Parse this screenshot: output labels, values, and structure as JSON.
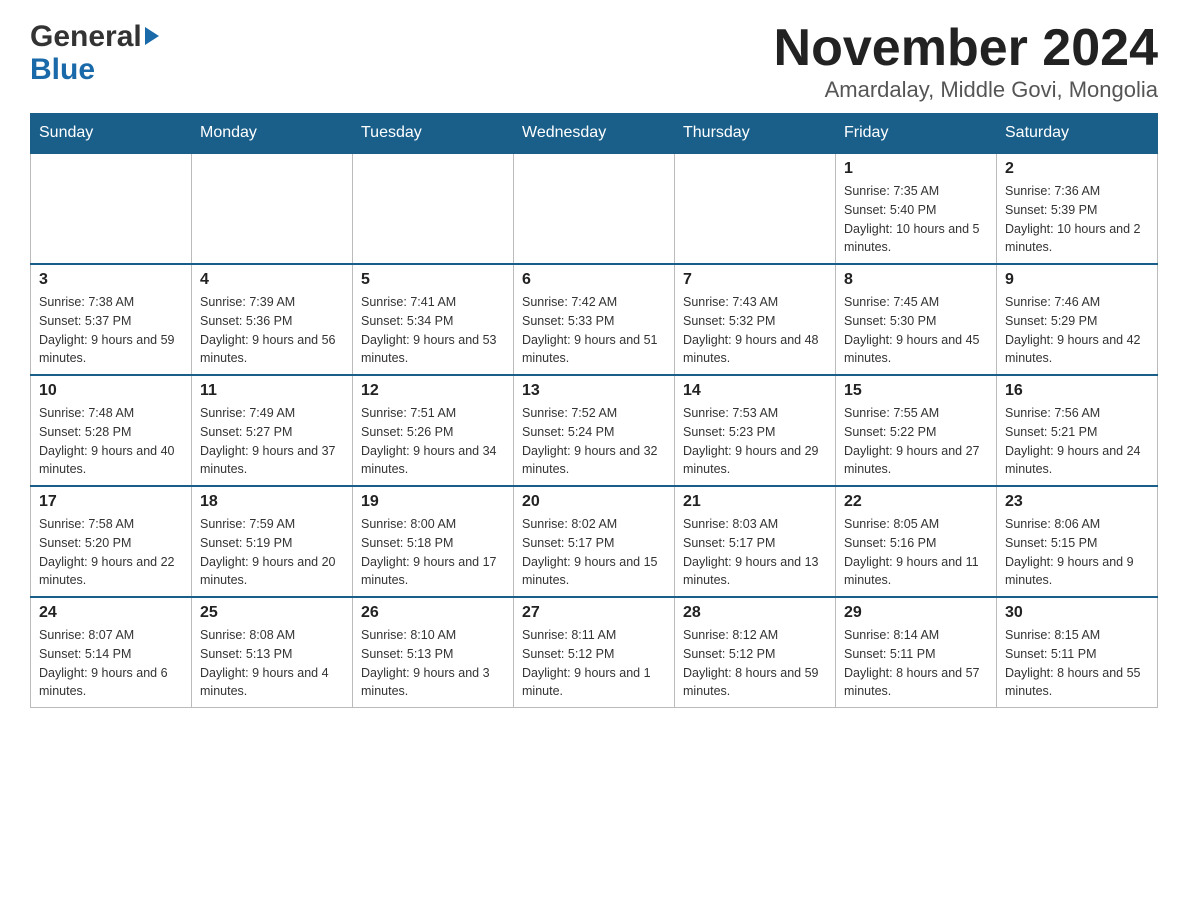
{
  "header": {
    "logo_line1": "General",
    "logo_line2": "Blue",
    "month_title": "November 2024",
    "location": "Amardalay, Middle Govi, Mongolia"
  },
  "days_of_week": [
    "Sunday",
    "Monday",
    "Tuesday",
    "Wednesday",
    "Thursday",
    "Friday",
    "Saturday"
  ],
  "weeks": [
    [
      {
        "day": "",
        "info": ""
      },
      {
        "day": "",
        "info": ""
      },
      {
        "day": "",
        "info": ""
      },
      {
        "day": "",
        "info": ""
      },
      {
        "day": "",
        "info": ""
      },
      {
        "day": "1",
        "info": "Sunrise: 7:35 AM\nSunset: 5:40 PM\nDaylight: 10 hours and 5 minutes."
      },
      {
        "day": "2",
        "info": "Sunrise: 7:36 AM\nSunset: 5:39 PM\nDaylight: 10 hours and 2 minutes."
      }
    ],
    [
      {
        "day": "3",
        "info": "Sunrise: 7:38 AM\nSunset: 5:37 PM\nDaylight: 9 hours and 59 minutes."
      },
      {
        "day": "4",
        "info": "Sunrise: 7:39 AM\nSunset: 5:36 PM\nDaylight: 9 hours and 56 minutes."
      },
      {
        "day": "5",
        "info": "Sunrise: 7:41 AM\nSunset: 5:34 PM\nDaylight: 9 hours and 53 minutes."
      },
      {
        "day": "6",
        "info": "Sunrise: 7:42 AM\nSunset: 5:33 PM\nDaylight: 9 hours and 51 minutes."
      },
      {
        "day": "7",
        "info": "Sunrise: 7:43 AM\nSunset: 5:32 PM\nDaylight: 9 hours and 48 minutes."
      },
      {
        "day": "8",
        "info": "Sunrise: 7:45 AM\nSunset: 5:30 PM\nDaylight: 9 hours and 45 minutes."
      },
      {
        "day": "9",
        "info": "Sunrise: 7:46 AM\nSunset: 5:29 PM\nDaylight: 9 hours and 42 minutes."
      }
    ],
    [
      {
        "day": "10",
        "info": "Sunrise: 7:48 AM\nSunset: 5:28 PM\nDaylight: 9 hours and 40 minutes."
      },
      {
        "day": "11",
        "info": "Sunrise: 7:49 AM\nSunset: 5:27 PM\nDaylight: 9 hours and 37 minutes."
      },
      {
        "day": "12",
        "info": "Sunrise: 7:51 AM\nSunset: 5:26 PM\nDaylight: 9 hours and 34 minutes."
      },
      {
        "day": "13",
        "info": "Sunrise: 7:52 AM\nSunset: 5:24 PM\nDaylight: 9 hours and 32 minutes."
      },
      {
        "day": "14",
        "info": "Sunrise: 7:53 AM\nSunset: 5:23 PM\nDaylight: 9 hours and 29 minutes."
      },
      {
        "day": "15",
        "info": "Sunrise: 7:55 AM\nSunset: 5:22 PM\nDaylight: 9 hours and 27 minutes."
      },
      {
        "day": "16",
        "info": "Sunrise: 7:56 AM\nSunset: 5:21 PM\nDaylight: 9 hours and 24 minutes."
      }
    ],
    [
      {
        "day": "17",
        "info": "Sunrise: 7:58 AM\nSunset: 5:20 PM\nDaylight: 9 hours and 22 minutes."
      },
      {
        "day": "18",
        "info": "Sunrise: 7:59 AM\nSunset: 5:19 PM\nDaylight: 9 hours and 20 minutes."
      },
      {
        "day": "19",
        "info": "Sunrise: 8:00 AM\nSunset: 5:18 PM\nDaylight: 9 hours and 17 minutes."
      },
      {
        "day": "20",
        "info": "Sunrise: 8:02 AM\nSunset: 5:17 PM\nDaylight: 9 hours and 15 minutes."
      },
      {
        "day": "21",
        "info": "Sunrise: 8:03 AM\nSunset: 5:17 PM\nDaylight: 9 hours and 13 minutes."
      },
      {
        "day": "22",
        "info": "Sunrise: 8:05 AM\nSunset: 5:16 PM\nDaylight: 9 hours and 11 minutes."
      },
      {
        "day": "23",
        "info": "Sunrise: 8:06 AM\nSunset: 5:15 PM\nDaylight: 9 hours and 9 minutes."
      }
    ],
    [
      {
        "day": "24",
        "info": "Sunrise: 8:07 AM\nSunset: 5:14 PM\nDaylight: 9 hours and 6 minutes."
      },
      {
        "day": "25",
        "info": "Sunrise: 8:08 AM\nSunset: 5:13 PM\nDaylight: 9 hours and 4 minutes."
      },
      {
        "day": "26",
        "info": "Sunrise: 8:10 AM\nSunset: 5:13 PM\nDaylight: 9 hours and 3 minutes."
      },
      {
        "day": "27",
        "info": "Sunrise: 8:11 AM\nSunset: 5:12 PM\nDaylight: 9 hours and 1 minute."
      },
      {
        "day": "28",
        "info": "Sunrise: 8:12 AM\nSunset: 5:12 PM\nDaylight: 8 hours and 59 minutes."
      },
      {
        "day": "29",
        "info": "Sunrise: 8:14 AM\nSunset: 5:11 PM\nDaylight: 8 hours and 57 minutes."
      },
      {
        "day": "30",
        "info": "Sunrise: 8:15 AM\nSunset: 5:11 PM\nDaylight: 8 hours and 55 minutes."
      }
    ]
  ]
}
